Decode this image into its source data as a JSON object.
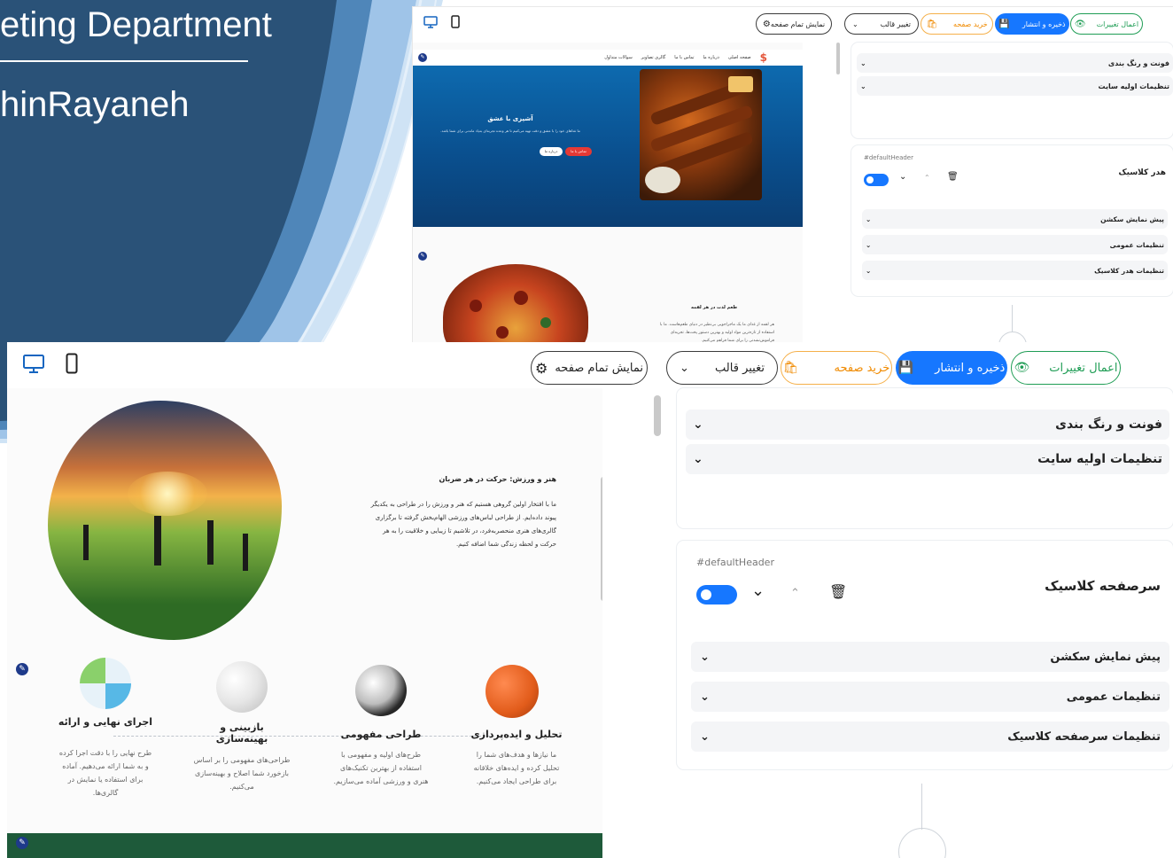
{
  "slide": {
    "title": "eting Department",
    "subtitle": "hinRayaneh",
    "colors": {
      "dark": "#2a5278",
      "mid": "#4f86b9",
      "light": "#9fc4e8"
    }
  },
  "toolbar": {
    "apply_changes": "اعمال تغییرات",
    "save_publish": "ذخیره و انتشار",
    "buy_page": "خرید صفحه",
    "change_template": "تغییر قالب",
    "full_preview": "نمایش تمام صفحه",
    "icons": [
      "desktop-icon",
      "mobile-icon",
      "eye-icon",
      "save-icon",
      "bag-icon",
      "chevron-down-icon",
      "gear-icon"
    ]
  },
  "site_settings": {
    "fonts_colors": "فونت و رنگ بندی",
    "initial_settings": "تنظیمات اولیه سایت"
  },
  "header_block_small": {
    "id": "#defaultHeader",
    "title": "هدر کلاسیک",
    "rows": [
      "پیش نمایش سکشن",
      "تنظیمات عمومی",
      "تنظیمات هدر کلاسیک"
    ]
  },
  "header_block_large": {
    "id": "#defaultHeader",
    "title": "سرصفحه کلاسیک",
    "rows": [
      "پیش نمایش سکشن",
      "تنظیمات عمومی",
      "تنظیمات سرصفحه کلاسیک"
    ]
  },
  "small_preview": {
    "nav": [
      "صفحه اصلی",
      "درباره ما",
      "تماس با ما",
      "گالری تصاویر",
      "سوالات متداول"
    ],
    "hero_title": "آشپزی با عشق",
    "hero_text": "ما غذاهای خود را با عشق و دقت تهیه می‌کنیم تا هر وعده تجربه‌ای به‌یاد ماندنی برای شما باشد.",
    "hero_btn_primary": "تماس با ما",
    "hero_btn_secondary": "درباره ما",
    "section2_title": "طعم لذت در هر لقمه",
    "section2_text": "هر لقمه از غذای ما یک ماجراجویی بی‌نظیر در دنیای طعم‌هاست. ما با استفاده از تازه‌ترین مواد اولیه و بهترین دستور پخت‌ها، تجربه‌ای فراموش‌نشدنی را برای شما فراهم می‌کنیم."
  },
  "large_preview": {
    "about_title": "هنر و ورزش: حرکت در هر ضربان",
    "about_text": "ما با افتخار اولین گروهی هستیم که هنر و ورزش را در طراحی به یکدیگر پیوند داده‌ایم. از طراحی لباس‌های ورزشی الهام‌بخش گرفته تا برگزاری گالری‌های هنری منحصربه‌فرد، در تلاشیم تا زیبایی و خلاقیت را به هر حرکت و لحظه زندگی شما اضافه کنیم.",
    "services": [
      {
        "title": "تحلیل و ایده‌پردازی",
        "desc": "ما نیازها و هدف‌های شما را تحلیل کرده و ایده‌های خلاقانه برای طراحی ایجاد می‌کنیم."
      },
      {
        "title": "طراحی مفهومی",
        "desc": "طرح‌های اولیه و مفهومی با استفاده از بهترین تکنیک‌های هنری و ورزشی آماده می‌سازیم."
      },
      {
        "title": "بازبینی و بهینه‌سازی",
        "desc": "طراحی‌های مفهومی را بر اساس بازخورد شما اصلاح و بهینه‌سازی می‌کنیم."
      },
      {
        "title": "اجرای نهایی و ارائه",
        "desc": "طرح نهایی را با دقت اجرا کرده و به شما ارائه می‌دهیم. آماده برای استفاده یا نمایش در گالری‌ها."
      }
    ]
  },
  "colors": {
    "accent_blue": "#1677ff",
    "green": "#1f9d55",
    "orange": "#f08a00",
    "toggle_blue": "#1677ff",
    "dark_green_band": "#1e5a3a"
  }
}
